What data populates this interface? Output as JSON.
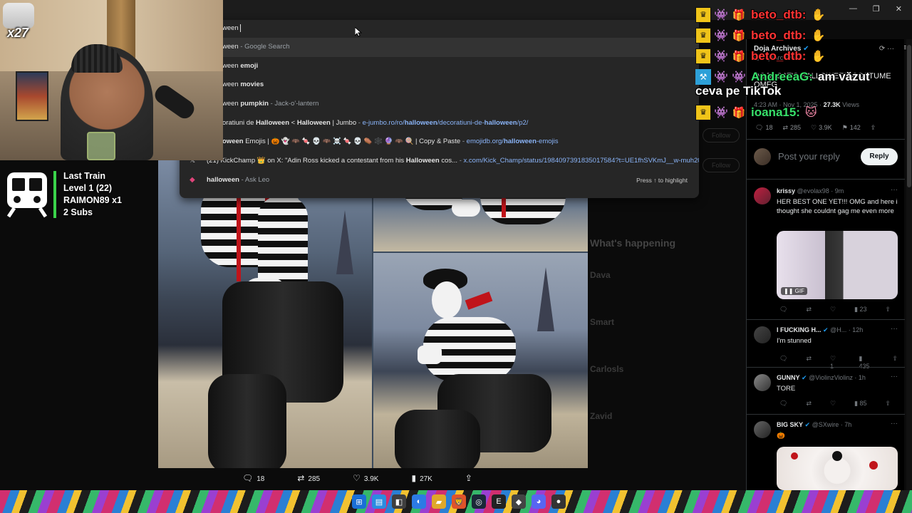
{
  "browser": {
    "window_controls": [
      "—",
      "❐",
      "✕"
    ],
    "address_text": "ween"
  },
  "omnibox": {
    "suggestions": [
      {
        "bold": "",
        "text": "ween",
        "suffix": " - Google Search",
        "url": "",
        "icon": "search-icon"
      },
      {
        "bold": "emoji",
        "text": "ween ",
        "suffix": "",
        "url": "",
        "icon": "search-icon"
      },
      {
        "bold": "movies",
        "text": "ween ",
        "suffix": "",
        "url": "",
        "icon": "search-icon"
      },
      {
        "bold": "pumpkin",
        "text": "ween ",
        "suffix": " - Jack-o'-lantern",
        "url": "",
        "icon": "search-icon"
      }
    ],
    "history": [
      {
        "pre": "oratiuni de ",
        "b1": "Halloween",
        "mid": " < ",
        "b2": "Halloween",
        "post": " | Jumbo",
        "dash": " - ",
        "url_pre": "e-jumbo.ro/ro/",
        "url_b1": "halloween",
        "url_mid": "/decoratiuni-de-",
        "url_b2": "halloween",
        "url_post": "/p2/"
      },
      {
        "pre": "",
        "b1": "oween",
        "mid": " Emojis | 🎃 👻 🦇 🍬 💀 🦇 ☠️ 🍬 💀 ⚰️ 🕸️ 🔮 🦇 🍭 ",
        "b2": "",
        "post": " | Copy & Paste",
        "dash": " - ",
        "url_pre": "emojidb.org/",
        "url_b1": "halloween",
        "url_mid": "-emojis",
        "url_b2": "",
        "url_post": ""
      }
    ],
    "x_row": {
      "pre": "(21) KickChamp 👑 on X: \"Adin Ross kicked a contestant from his ",
      "bold": "Halloween",
      "post": " cos...",
      "dash": " - ",
      "url": "x.com/Kick_Champ/status/1984097391835017584?t=UE1fhSVKmJ__w-muh20ae..."
    },
    "leo_row": {
      "bold": "halloween",
      "suffix": " - Ask Leo",
      "hint": "Press ↑ to highlight"
    }
  },
  "webcam": {
    "multiplier": "x27"
  },
  "train_widget": {
    "line1": "Last Train",
    "line2": "Level 1  (22)",
    "line3": "RAIMON89 x1",
    "line4": "2 Subs"
  },
  "chat": [
    {
      "user": "beto_dtb:",
      "text": "",
      "badges": [
        "crown",
        "ghost",
        "gift"
      ],
      "color": "#ff3333",
      "emote": "✋"
    },
    {
      "user": "beto_dtb:",
      "text": "",
      "badges": [
        "crown",
        "ghost",
        "gift"
      ],
      "color": "#ff3333",
      "emote": "✋"
    },
    {
      "user": "beto_dtb:",
      "text": "",
      "badges": [
        "crown",
        "ghost",
        "gift"
      ],
      "color": "#ff3333",
      "emote": "✋"
    },
    {
      "user": "AndreeaG:",
      "text": "am văzut",
      "badges": [
        "sword",
        "ghost",
        "ghost"
      ],
      "color": "#37e06a",
      "emote": ""
    },
    {
      "user": "ioana15:",
      "text": "",
      "badges": [
        "crown",
        "ghost",
        "gift"
      ],
      "color": "#37e06a",
      "emote": "🐱"
    }
  ],
  "chat_wrap_line": "ceva pe TikTok",
  "post_actions": {
    "replies": "18",
    "reposts": "285",
    "likes": "3.9K",
    "views": "27K"
  },
  "faded_trends": {
    "heading": "What's happening",
    "items": [
      "Dava",
      "Smart",
      "Carlosls",
      "Zavid"
    ],
    "follow_label": "Follow"
  },
  "side": {
    "author": "Doja Archives",
    "handle": "@DojaArchive",
    "title": "DOJA CAT'S HALLOWEEN COSTUME OMFG",
    "time": "4:23 AM · Nov 1, 2025 · ",
    "views_count": "27.3K",
    "views_label": " Views",
    "stats": {
      "replies": "18",
      "reposts": "285",
      "likes": "3.9K",
      "bookmarks": "142"
    },
    "reply_placeholder": "Post your reply",
    "reply_button": "Reply",
    "replies": [
      {
        "name": "krissy",
        "handle": "@evolax98 · 9m",
        "verified": false,
        "body": "HER BEST ONE YET!!! OMG and here i thought she couldnt gag me even more",
        "stats": {
          "views": "23"
        },
        "has_media": true,
        "media_badge": "GIF"
      },
      {
        "name": "I FUCKING H...",
        "handle": "@H... · 12h",
        "verified": true,
        "body": "I'm stunned",
        "stats": {
          "likes": "1",
          "views": "435"
        }
      },
      {
        "name": "GUNNY",
        "handle": "@ViolinzViolinz · 1h",
        "verified": true,
        "body": "TORE",
        "stats": {
          "views": "85"
        }
      },
      {
        "name": "BIG SKY",
        "handle": "@SXwire · 7h",
        "verified": true,
        "body": "🎃",
        "stats": {},
        "has_media": true
      }
    ]
  },
  "colors": {
    "accent_blue": "#1d9bf0",
    "chat_red": "#ff3333",
    "chat_green": "#37e06a",
    "train_green": "#3ad34a"
  }
}
